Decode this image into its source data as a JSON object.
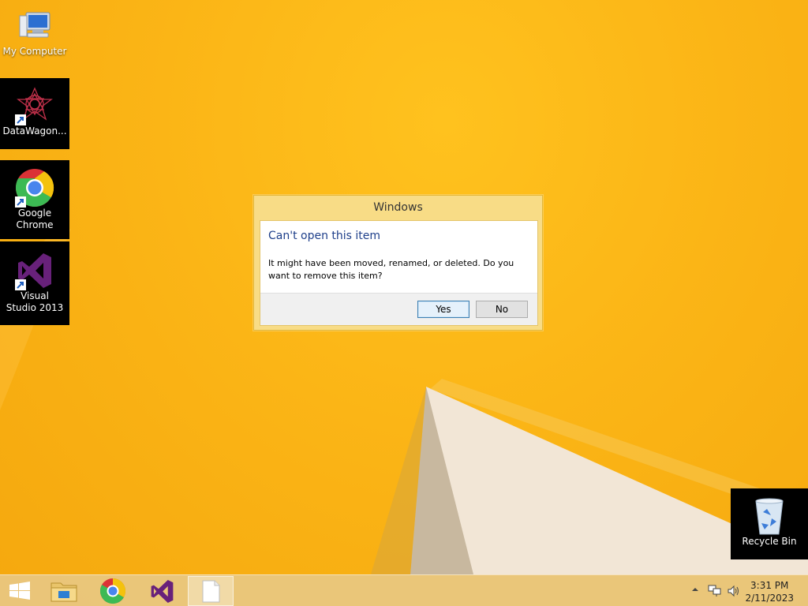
{
  "desktop": {
    "icons": [
      {
        "label": "My Computer"
      },
      {
        "label": "DataWagon..."
      },
      {
        "label": "Google Chrome"
      },
      {
        "label": "Visual Studio 2013"
      },
      {
        "label": "Recycle Bin"
      }
    ]
  },
  "dialog": {
    "title": "Windows",
    "heading": "Can't open this item",
    "message": "It might have been moved, renamed, or deleted. Do you want to remove this item?",
    "yes_label": "Yes",
    "no_label": "No"
  },
  "taskbar": {
    "time": "3:31 PM",
    "date": "2/11/2023",
    "pinned": [
      "start-icon",
      "file-explorer-icon",
      "chrome-icon",
      "visual-studio-icon",
      "blank-document-icon"
    ]
  },
  "colors": {
    "wallpaper": "#fbb516",
    "dialog_frame": "#f8dc86",
    "heading_blue": "#1e3f8a"
  }
}
